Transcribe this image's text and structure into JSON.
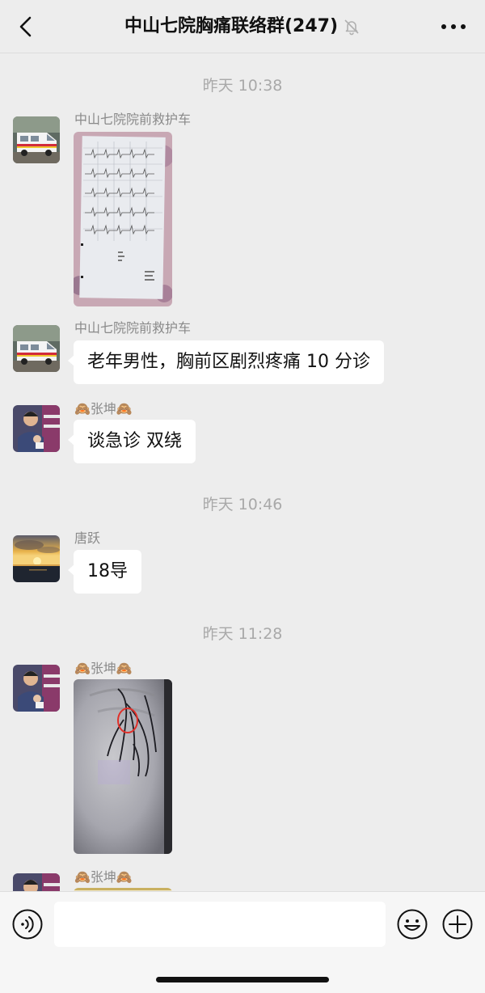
{
  "header": {
    "title": "中山七院胸痛联络群(247)",
    "back_icon": "chevron-left-icon",
    "mute_icon": "bell-muted-icon",
    "more_icon": "ellipsis-icon"
  },
  "messages": [
    {
      "type": "time",
      "text": "昨天 10:38"
    },
    {
      "type": "image",
      "sender": "中山七院院前救护车",
      "avatar": "ambulance",
      "image_desc": "ecg-printout"
    },
    {
      "type": "text",
      "sender": "中山七院院前救护车",
      "avatar": "ambulance",
      "text": "老年男性，胸前区剧烈疼痛 10 分诊"
    },
    {
      "type": "text",
      "sender": "🙈张坤🙈",
      "avatar": "person",
      "text": "谈急诊 双绕"
    },
    {
      "type": "time",
      "text": "昨天 10:46"
    },
    {
      "type": "text",
      "sender": "唐跃",
      "avatar": "sunset",
      "text": "18导"
    },
    {
      "type": "time",
      "text": "昨天 11:28"
    },
    {
      "type": "image",
      "sender": "🙈张坤🙈",
      "avatar": "person",
      "image_desc": "angiogram"
    },
    {
      "type": "image",
      "sender": "🙈张坤🙈",
      "avatar": "person",
      "image_desc": "partial"
    }
  ],
  "input_bar": {
    "voice_icon": "voice-icon",
    "input_value": "",
    "emoji_icon": "emoji-icon",
    "plus_icon": "plus-icon"
  }
}
